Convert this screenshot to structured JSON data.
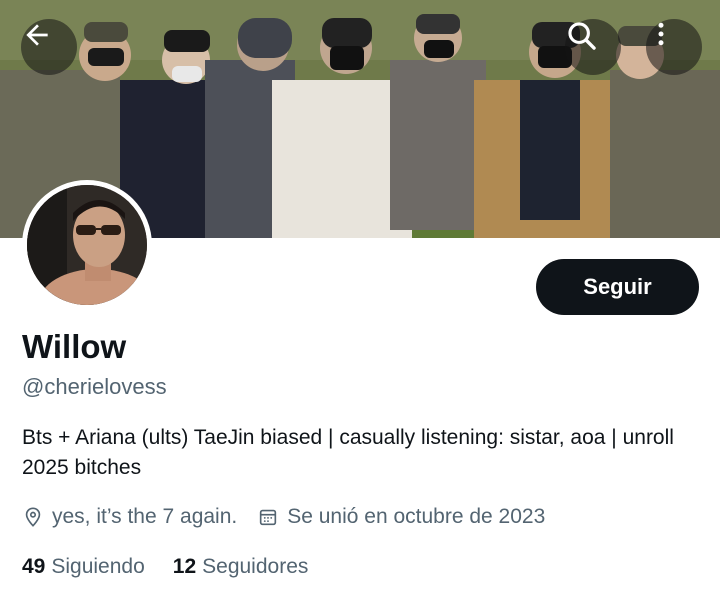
{
  "profile": {
    "name": "Willow",
    "handle": "@cherielovess",
    "bio": "Bts + Ariana (ults) TaeJin biased | casually listening: sistar, aoa | unroll 2025 bitches",
    "location": "yes, it’s the 7 again.",
    "joined": "Se unió en octubre de 2023"
  },
  "actions": {
    "follow_label": "Seguir"
  },
  "stats": {
    "following_count": "49",
    "following_label": "Siguiendo",
    "followers_count": "12",
    "followers_label": "Seguidores"
  },
  "icons": {
    "back": "arrow-left-icon",
    "search": "search-icon",
    "more": "more-vertical-icon",
    "location": "location-pin-icon",
    "calendar": "calendar-icon"
  },
  "colors": {
    "primary_text": "#0f1419",
    "secondary_text": "#536471",
    "button_bg": "#0f1419",
    "button_text": "#ffffff"
  }
}
